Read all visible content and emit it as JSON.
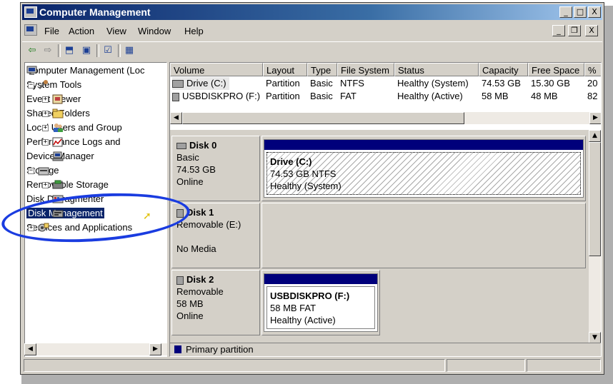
{
  "window": {
    "title": "Computer Management"
  },
  "caption_buttons": [
    "_",
    "□",
    "X"
  ],
  "mdi_buttons": [
    "_",
    "❐",
    "X"
  ],
  "menu": [
    "File",
    "Action",
    "View",
    "Window",
    "Help"
  ],
  "toolbar_icons": [
    "back-icon",
    "forward-icon",
    "up-icon",
    "show-hide-tree-icon",
    "properties-icon",
    "help-icon"
  ],
  "tree": {
    "root": "Computer Management (Loc",
    "system_tools": "System Tools",
    "event_viewer": "Event Viewer",
    "shared_folders": "Shared Folders",
    "local_users": "Local Users and Group",
    "perf_logs": "Performance Logs and",
    "device_manager": "Device Manager",
    "storage": "Storage",
    "removable_storage": "Removable Storage",
    "disk_defrag": "Disk Defragmenter",
    "disk_management": "Disk Management",
    "services": "Services and Applications"
  },
  "volume_table": {
    "headers": [
      "Volume",
      "Layout",
      "Type",
      "File System",
      "Status",
      "Capacity",
      "Free Space",
      "%"
    ],
    "rows": [
      [
        "Drive (C:)",
        "Partition",
        "Basic",
        "NTFS",
        "Healthy (System)",
        "74.53 GB",
        "15.30 GB",
        "20"
      ],
      [
        "USBDISKPRO (F:)",
        "Partition",
        "Basic",
        "FAT",
        "Healthy (Active)",
        "58 MB",
        "48 MB",
        "82"
      ]
    ]
  },
  "disks": {
    "disk0": {
      "name": "Disk 0",
      "type": "Basic",
      "size": "74.53 GB",
      "state": "Online",
      "partition": {
        "name": "Drive  (C:)",
        "size": "74.53 GB NTFS",
        "status": "Healthy (System)"
      }
    },
    "disk1": {
      "name": "Disk 1",
      "type": "Removable (E:)",
      "media": "No Media"
    },
    "disk2": {
      "name": "Disk 2",
      "type": "Removable",
      "size": "58 MB",
      "state": "Online",
      "partition": {
        "name": "USBDISKPRO  (F:)",
        "size": "58 MB FAT",
        "status": "Healthy (Active)"
      }
    }
  },
  "legend": {
    "label": "Primary partition",
    "color": "#00007b"
  },
  "colors": {
    "title_start": "#0a246a",
    "title_end": "#a6caf0",
    "selection": "#0a246a",
    "callout": "#1a3ce0"
  }
}
